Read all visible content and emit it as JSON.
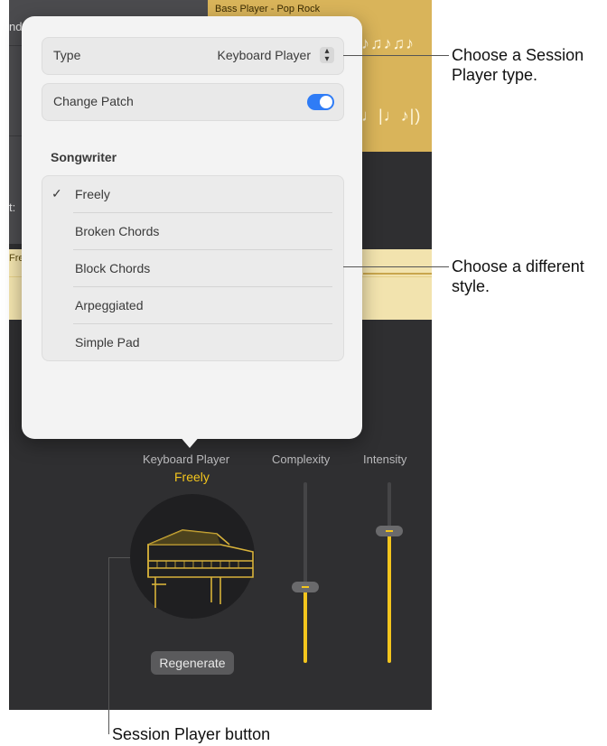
{
  "background": {
    "region_title": "Bass Player - Pop Rock",
    "side_label_top": "nd",
    "side_label_mid": "t:",
    "region_label_fr": "Fre"
  },
  "popover": {
    "type_label": "Type",
    "type_value": "Keyboard Player",
    "change_patch_label": "Change Patch",
    "change_patch_on": true,
    "section_title": "Songwriter",
    "styles": [
      "Freely",
      "Broken Chords",
      "Block Chords",
      "Arpeggiated",
      "Simple Pad"
    ],
    "selected_style": "Freely",
    "check_glyph": "✓"
  },
  "controls": {
    "player_name": "Keyboard Player",
    "player_style": "Freely",
    "complexity_label": "Complexity",
    "intensity_label": "Intensity",
    "regenerate_label": "Regenerate",
    "complexity_level": 0.42,
    "intensity_level": 0.73
  },
  "annotations": {
    "type_callout": "Choose a Session Player type.",
    "style_callout": "Choose a different style.",
    "button_callout": "Session Player button"
  },
  "colors": {
    "accent_yellow": "#f3c51d",
    "toggle_blue": "#2f7cf6",
    "region_gold": "#d9b45a"
  }
}
